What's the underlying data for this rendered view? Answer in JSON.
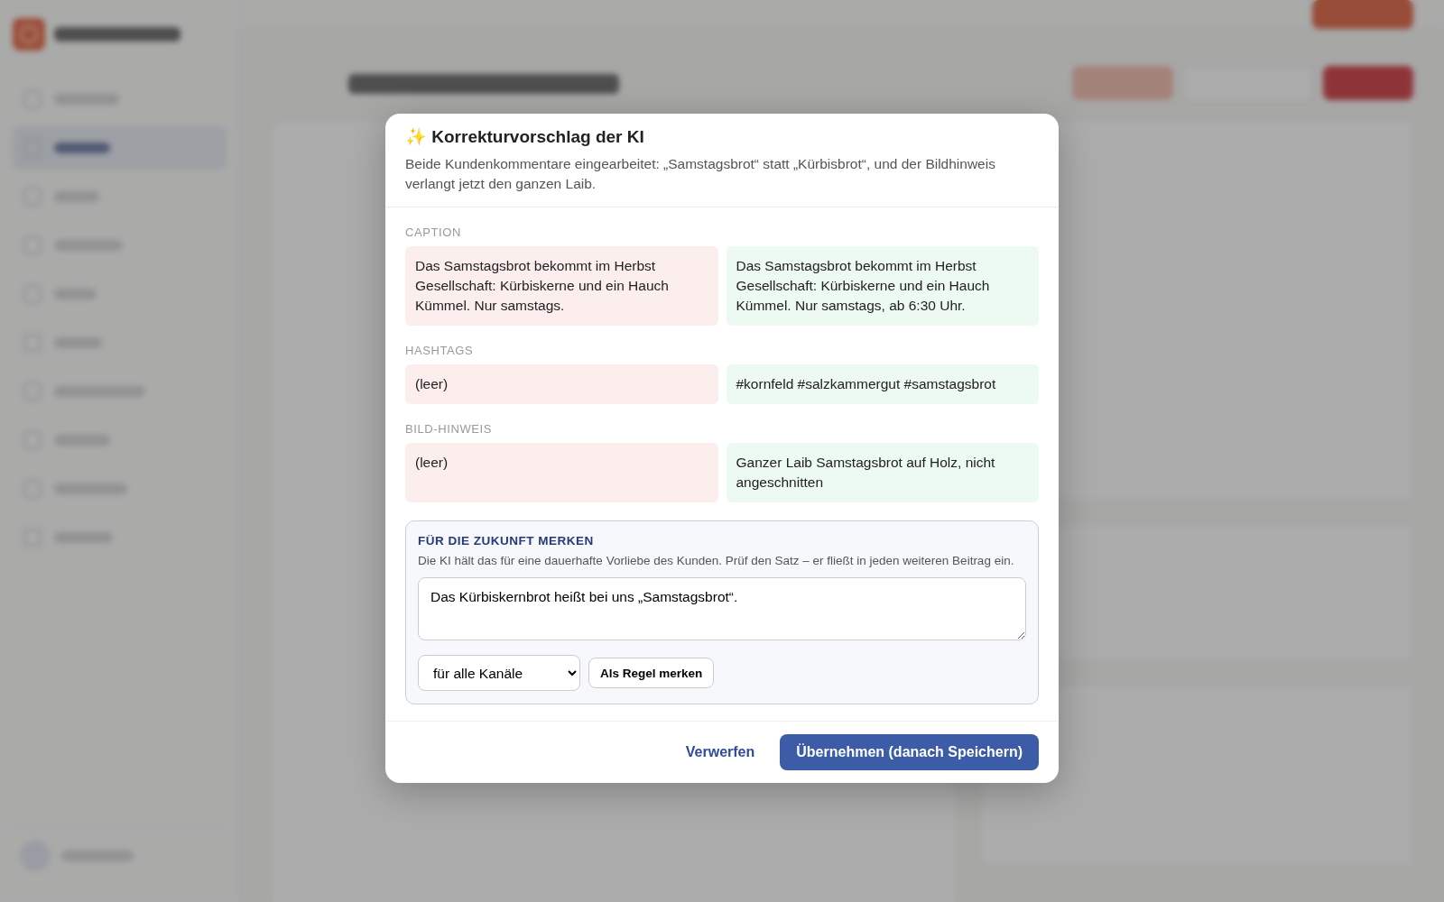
{
  "sidebar": {
    "nav": [
      {
        "selected": false
      },
      {
        "selected": true
      },
      {
        "selected": false
      },
      {
        "selected": false
      },
      {
        "selected": false
      },
      {
        "selected": false
      },
      {
        "selected": false
      },
      {
        "selected": false
      },
      {
        "selected": false
      },
      {
        "selected": false
      }
    ]
  },
  "dialog": {
    "icon": "✨",
    "title": "Korrekturvorschlag der KI",
    "summary": "Beide Kundenkommentare eingearbeitet: „Samstagsbrot“ statt „Kürbisbrot“, und der Bildhinweis verlangt jetzt den ganzen Laib.",
    "changes": [
      {
        "label": "CAPTION",
        "old": "Das Samstagsbrot bekommt im Herbst Gesellschaft: Kürbiskerne und ein Hauch Kümmel. Nur samstags.",
        "new": "Das Samstagsbrot bekommt im Herbst Gesellschaft: Kürbiskerne und ein Hauch Kümmel. Nur samstags, ab 6:30 Uhr."
      },
      {
        "label": "HASHTAGS",
        "old": "(leer)",
        "new": "#kornfeld #salzkammergut #samstagsbrot"
      },
      {
        "label": "BILD-HINWEIS",
        "old": "(leer)",
        "new": "Ganzer Laib Samstagsbrot auf Holz, nicht angeschnitten"
      }
    ],
    "remember": {
      "title": "FÜR DIE ZUKUNFT MERKEN",
      "hint": "Die KI hält das für eine dauerhafte Vorliebe des Kunden. Prüf den Satz – er fließt in jeden weiteren Beitrag ein.",
      "rule": "Das Kürbiskernbrot heißt bei uns „Samstagsbrot“.",
      "scope": "für alle Kanäle",
      "save_button": "Als Regel merken"
    },
    "buttons": [
      {
        "label": "Verwerfen",
        "kind": "secondary"
      },
      {
        "label": "Übernehmen (danach Speichern)",
        "kind": "primary"
      }
    ]
  }
}
